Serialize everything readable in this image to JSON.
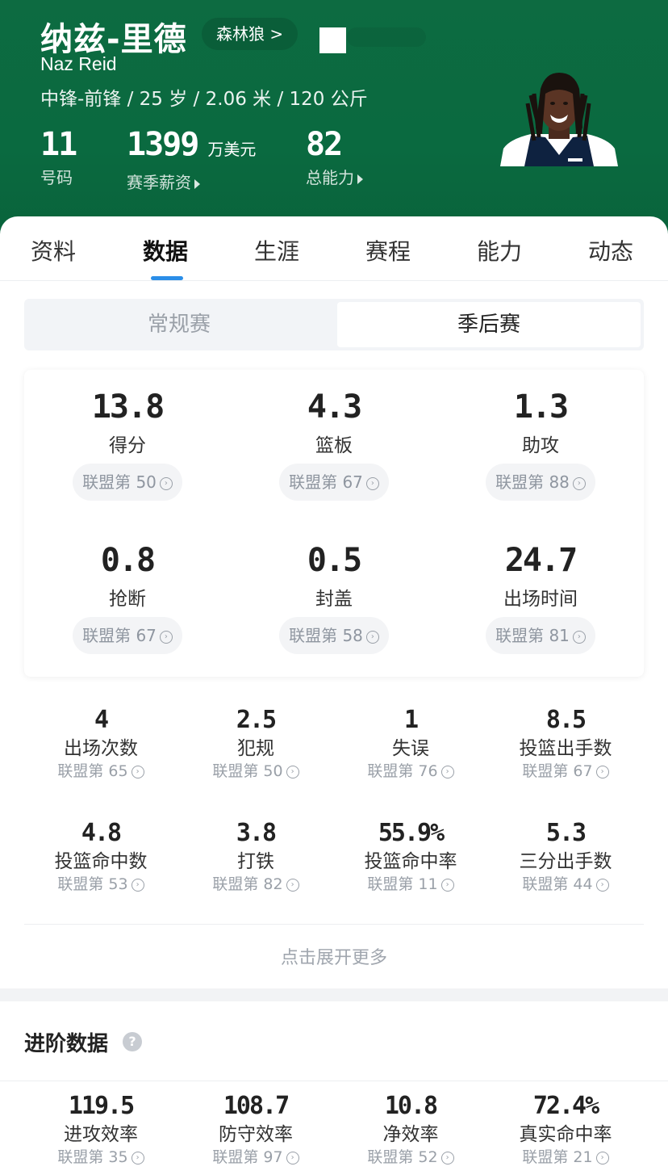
{
  "header": {
    "name_cn": "纳兹-里德",
    "team_label": "森林狼 >",
    "name_en": "Naz Reid",
    "bio": "中锋-前锋 / 25 岁 / 2.06 米 / 120 公斤",
    "number_value": "11",
    "number_label": "号码",
    "salary_value": "1399",
    "salary_unit": "万美元",
    "salary_label": "赛季薪资",
    "rating_value": "82",
    "rating_label": "总能力"
  },
  "tabs": [
    {
      "label": "资料"
    },
    {
      "label": "数据"
    },
    {
      "label": "生涯"
    },
    {
      "label": "赛程"
    },
    {
      "label": "能力"
    },
    {
      "label": "动态"
    }
  ],
  "season_toggle": {
    "regular": "常规赛",
    "playoffs": "季后赛"
  },
  "main_stats": [
    {
      "value": "13.8",
      "label": "得分",
      "rank": "联盟第 50"
    },
    {
      "value": "4.3",
      "label": "篮板",
      "rank": "联盟第 67"
    },
    {
      "value": "1.3",
      "label": "助攻",
      "rank": "联盟第 88"
    },
    {
      "value": "0.8",
      "label": "抢断",
      "rank": "联盟第 67"
    },
    {
      "value": "0.5",
      "label": "封盖",
      "rank": "联盟第 58"
    },
    {
      "value": "24.7",
      "label": "出场时间",
      "rank": "联盟第 81"
    }
  ],
  "secondary_stats": [
    {
      "value": "4",
      "label": "出场次数",
      "rank": "联盟第 65"
    },
    {
      "value": "2.5",
      "label": "犯规",
      "rank": "联盟第 50"
    },
    {
      "value": "1",
      "label": "失误",
      "rank": "联盟第 76"
    },
    {
      "value": "8.5",
      "label": "投篮出手数",
      "rank": "联盟第 67"
    },
    {
      "value": "4.8",
      "label": "投篮命中数",
      "rank": "联盟第 53"
    },
    {
      "value": "3.8",
      "label": "打铁",
      "rank": "联盟第 82"
    },
    {
      "value": "55.9%",
      "label": "投篮命中率",
      "rank": "联盟第 11"
    },
    {
      "value": "5.3",
      "label": "三分出手数",
      "rank": "联盟第 44"
    }
  ],
  "expand_label": "点击展开更多",
  "advanced": {
    "title": "进阶数据",
    "help": "?",
    "stats": [
      {
        "value": "119.5",
        "label": "进攻效率",
        "rank": "联盟第 35"
      },
      {
        "value": "108.7",
        "label": "防守效率",
        "rank": "联盟第 97"
      },
      {
        "value": "10.8",
        "label": "净效率",
        "rank": "联盟第 52"
      },
      {
        "value": "72.4%",
        "label": "真实命中率",
        "rank": "联盟第 21"
      }
    ]
  },
  "colors": {
    "header_green": "#0a6a40",
    "tab_accent": "#2b8ee8"
  }
}
